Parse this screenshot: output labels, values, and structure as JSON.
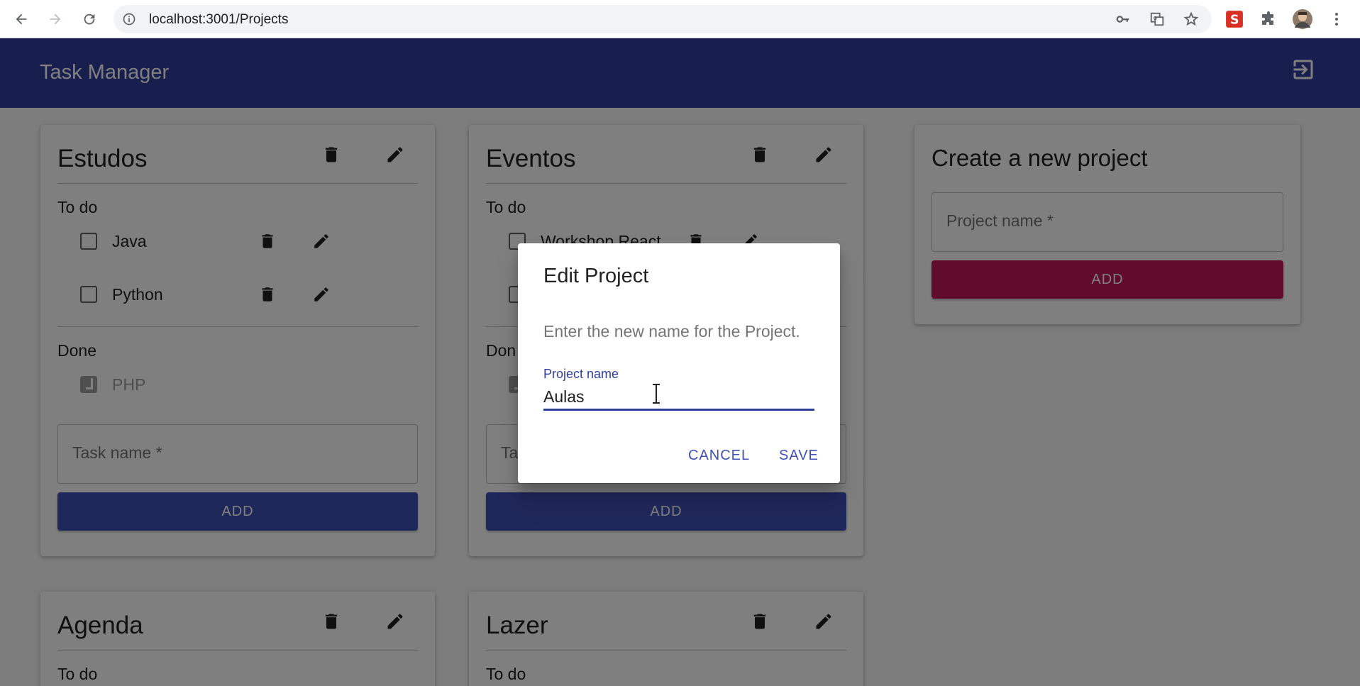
{
  "browser": {
    "url": "localhost:3001/Projects"
  },
  "app": {
    "title": "Task Manager"
  },
  "projects": [
    {
      "name": "Estudos",
      "todo_label": "To do",
      "todo": [
        "Java",
        "Python"
      ],
      "done_label": "Done",
      "done": [
        "PHP"
      ],
      "task_placeholder": "Task name *",
      "add_label": "ADD"
    },
    {
      "name": "Eventos",
      "todo_label": "To do",
      "todo": [
        "Workshop React",
        ""
      ],
      "done_label": "Don",
      "done": [
        ""
      ],
      "task_placeholder": "Ta",
      "add_label": "ADD"
    },
    {
      "name": "Agenda",
      "todo_label": "To do"
    },
    {
      "name": "Lazer",
      "todo_label": "To do"
    }
  ],
  "create_project": {
    "title": "Create a new project",
    "placeholder": "Project name *",
    "add_label": "ADD"
  },
  "dialog": {
    "title": "Edit Project",
    "text": "Enter the new name for the Project.",
    "field_label": "Project name",
    "field_value": "Aulas",
    "cancel_label": "CANCEL",
    "save_label": "SAVE"
  },
  "colors": {
    "primary": "#303f9f",
    "button_blue": "#3f51b5",
    "button_pink": "#c2185b"
  }
}
